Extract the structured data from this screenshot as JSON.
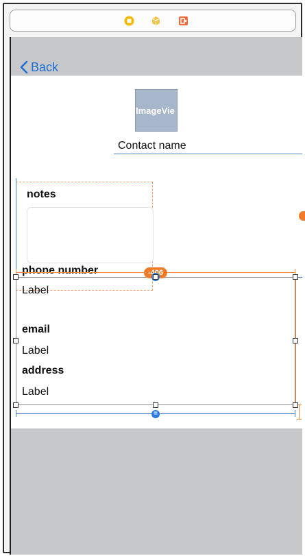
{
  "toolbar": {
    "icons": [
      "view-controller-icon",
      "first-responder-icon",
      "exit-icon"
    ],
    "colors": {
      "vc": "#f5b800",
      "responder": "#f3c64a",
      "exit": "#ee6b3b"
    }
  },
  "nav": {
    "back_label": "Back"
  },
  "content": {
    "image_view_label": "ImageVie",
    "contact_name": "Contact name",
    "notes_title": "notes",
    "phone_title": "phone number",
    "phone_value": "Label",
    "email_title": "email",
    "email_value": "Label",
    "address_title": "address",
    "address_value": "Label"
  },
  "constraints": {
    "badge_value": "-406",
    "equal_marker": "="
  },
  "colors": {
    "accent_blue": "#1f6fd6",
    "constraint_orange": "#f08a3c",
    "selection_blue": "#3d7bd0"
  }
}
